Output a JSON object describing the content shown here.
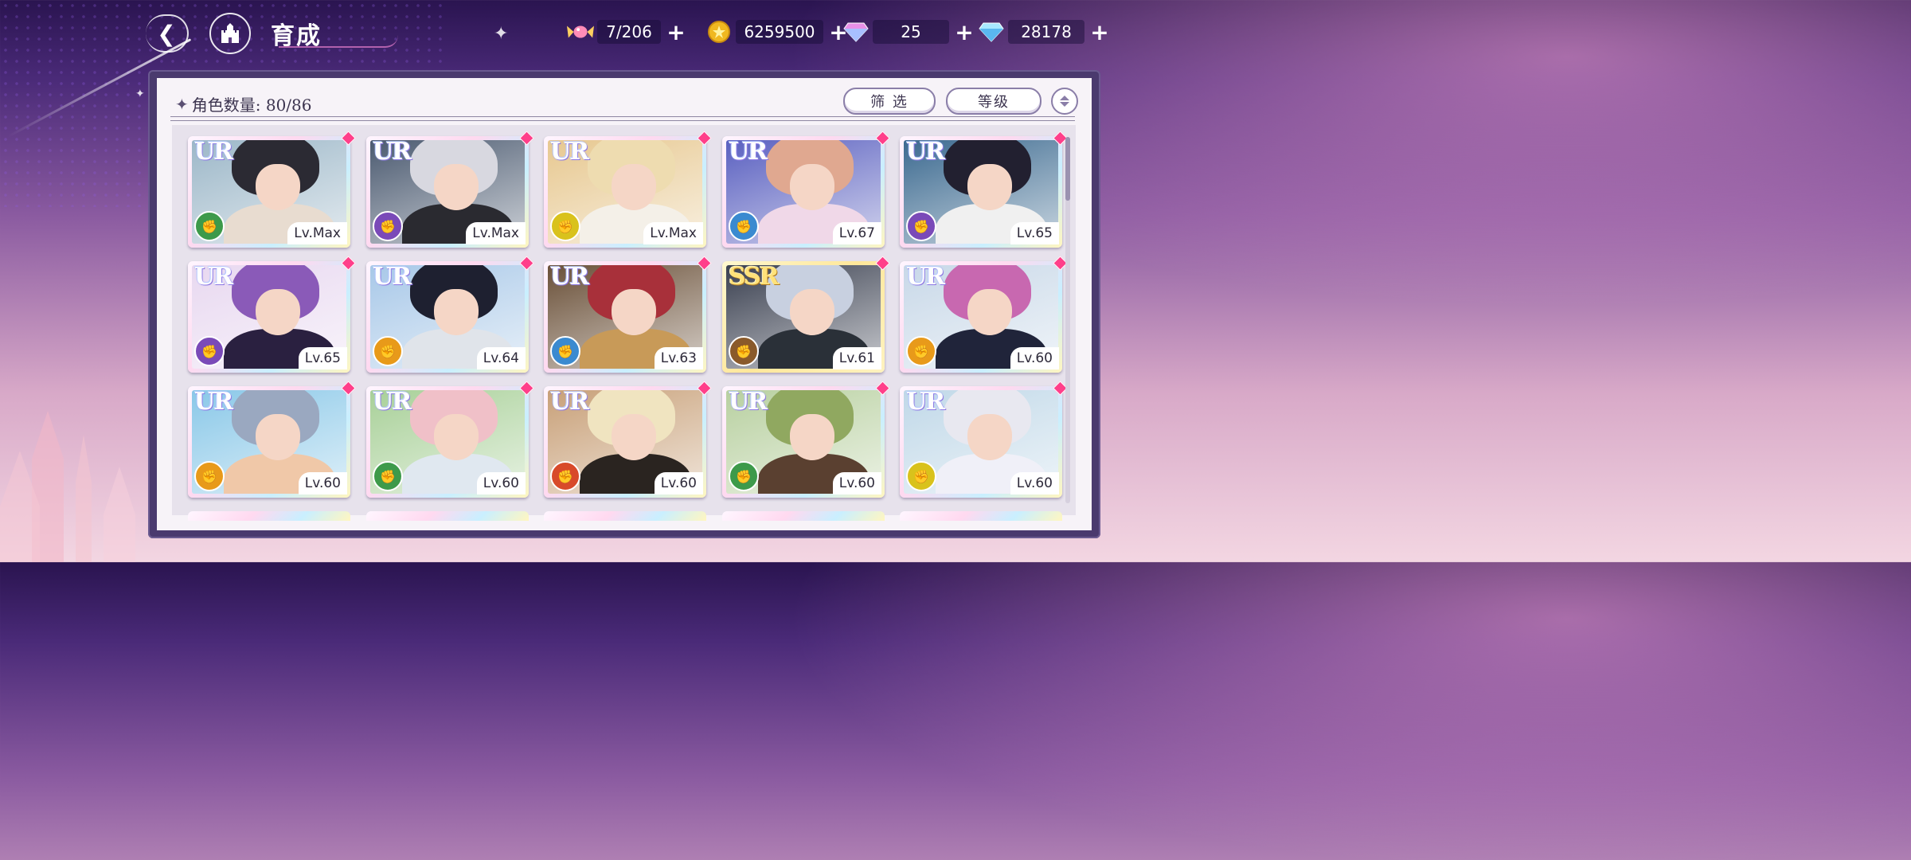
{
  "header": {
    "title": "育成",
    "back_icon": "back-arrow-icon",
    "home_icon": "castle-home-icon"
  },
  "currencies": [
    {
      "icon": "candy-icon",
      "value": "7/206"
    },
    {
      "icon": "gold-coin-icon",
      "value": "6259500"
    },
    {
      "icon": "pink-diamond-icon",
      "value": "25"
    },
    {
      "icon": "blue-diamond-icon",
      "value": "28178"
    }
  ],
  "toolbar": {
    "count_label": "角色数量: 80/86",
    "filter_label": "筛 选",
    "sort_label": "等级"
  },
  "elements": {
    "green": "#3d9a4a",
    "purple": "#7a4ab8",
    "yellow": "#d9c21c",
    "blue": "#3a8ad0",
    "orange": "#e89a1a",
    "brown": "#8a5a2a",
    "red": "#d84a2a"
  },
  "cards": [
    {
      "rarity": "UR",
      "level": "Lv.Max",
      "element": "green",
      "hair": "#2b2a33",
      "bg": "#9cb7c8",
      "outfit": "#e8dcd0"
    },
    {
      "rarity": "UR",
      "level": "Lv.Max",
      "element": "purple",
      "hair": "#d8d8e0",
      "bg": "#4b5a70",
      "outfit": "#2a2a30"
    },
    {
      "rarity": "UR",
      "level": "Lv.Max",
      "element": "yellow",
      "hair": "#eedcb0",
      "bg": "#e7c890",
      "outfit": "#f4f0e8"
    },
    {
      "rarity": "UR",
      "level": "Lv.67",
      "element": "blue",
      "hair": "#e0a890",
      "bg": "#5a60c0",
      "outfit": "#f0d8e8"
    },
    {
      "rarity": "UR",
      "level": "Lv.65",
      "element": "purple",
      "hair": "#222030",
      "bg": "#3c6a90",
      "outfit": "#f0f0f0"
    },
    {
      "rarity": "UR",
      "level": "Lv.65",
      "element": "purple",
      "hair": "#8a5ab8",
      "bg": "#e8d8f0",
      "outfit": "#2a2040"
    },
    {
      "rarity": "UR",
      "level": "Lv.64",
      "element": "orange",
      "hair": "#1e2030",
      "bg": "#a8c8e8",
      "outfit": "#e0e4ea"
    },
    {
      "rarity": "UR",
      "level": "Lv.63",
      "element": "blue",
      "hair": "#a8303a",
      "bg": "#6a5038",
      "outfit": "#c89a58"
    },
    {
      "rarity": "SSR",
      "level": "Lv.61",
      "element": "brown",
      "hair": "#c8d0e0",
      "bg": "#3a4050",
      "outfit": "#2a3038"
    },
    {
      "rarity": "UR",
      "level": "Lv.60",
      "element": "orange",
      "hair": "#c868b0",
      "bg": "#c8d8e8",
      "outfit": "#20243a"
    },
    {
      "rarity": "UR",
      "level": "Lv.60",
      "element": "orange",
      "hair": "#9aa8c0",
      "bg": "#8ac8e8",
      "outfit": "#f0c8a8"
    },
    {
      "rarity": "UR",
      "level": "Lv.60",
      "element": "green",
      "hair": "#f0c0c8",
      "bg": "#a8d098",
      "outfit": "#e0e8f0"
    },
    {
      "rarity": "UR",
      "level": "Lv.60",
      "element": "red",
      "hair": "#f0e4c0",
      "bg": "#c8a078",
      "outfit": "#2a2420"
    },
    {
      "rarity": "UR",
      "level": "Lv.60",
      "element": "green",
      "hair": "#90a860",
      "bg": "#b8d0a0",
      "outfit": "#5a4030"
    },
    {
      "rarity": "UR",
      "level": "Lv.60",
      "element": "yellow",
      "hair": "#e8e8f0",
      "bg": "#c0d8e8",
      "outfit": "#f0f0f8"
    }
  ]
}
